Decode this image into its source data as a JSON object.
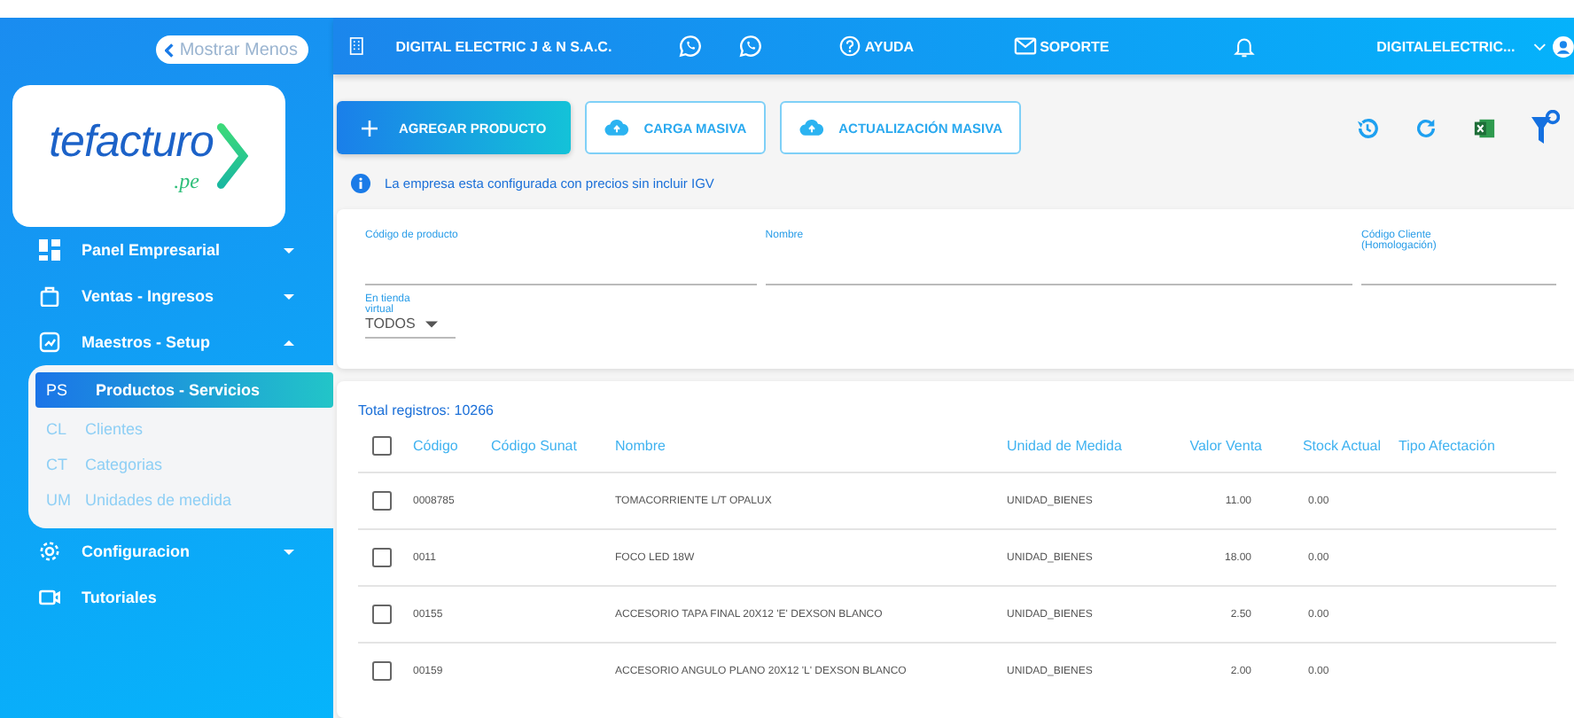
{
  "topbar": {
    "company": "DIGITAL ELECTRIC J & N S.A.C.",
    "help": "AYUDA",
    "support": "SOPORTE",
    "user": "DIGITALELECTRIC..."
  },
  "sidebar": {
    "collapse_label": "Mostrar Menos",
    "logo": {
      "name": "tefacturo",
      "domain": ".pe"
    },
    "items": [
      {
        "label": "Panel Empresarial",
        "kind": "group",
        "expanded": false
      },
      {
        "label": "Ventas - Ingresos",
        "kind": "group",
        "expanded": false
      },
      {
        "label": "Maestros - Setup",
        "kind": "group",
        "expanded": true,
        "children": [
          {
            "abbr": "PS",
            "label": "Productos - Servicios",
            "selected": true
          },
          {
            "abbr": "CL",
            "label": "Clientes",
            "selected": false
          },
          {
            "abbr": "CT",
            "label": "Categorias",
            "selected": false
          },
          {
            "abbr": "UM",
            "label": "Unidades de medida",
            "selected": false
          }
        ]
      },
      {
        "label": "Configuracion",
        "kind": "group",
        "expanded": false
      },
      {
        "label": "Tutoriales",
        "kind": "link"
      }
    ]
  },
  "toolbar": {
    "buttons": [
      {
        "label": "AGREGAR PRODUCTO",
        "kind": "primary"
      },
      {
        "label": "CARGA MASIVA",
        "kind": "outline"
      },
      {
        "label": "ACTUALIZACIÓN MASIVA",
        "kind": "outline"
      }
    ],
    "notice": "La empresa esta configurada con precios sin incluir IGV"
  },
  "filters": {
    "fields": [
      {
        "label": "Código de producto"
      },
      {
        "label": "Nombre"
      },
      {
        "label": "Código Cliente (Homologación)"
      }
    ],
    "select": {
      "label": "En tienda virtual",
      "value": "TODOS"
    }
  },
  "table": {
    "total": "Total registros: 10266",
    "all_checked": false,
    "columns": [
      "Código",
      "Código Sunat",
      "Nombre",
      "Unidad de Medida",
      "Valor Venta",
      "Stock Actual",
      "Tipo Afectación"
    ],
    "rows": [
      {
        "checked": false,
        "cells": [
          "0008785",
          "",
          "TOMACORRIENTE L/T OPALUX",
          "UNIDAD_BIENES",
          "11.00",
          "0.00",
          ""
        ]
      },
      {
        "checked": false,
        "cells": [
          "0011",
          "",
          "FOCO LED 18W",
          "UNIDAD_BIENES",
          "18.00",
          "0.00",
          ""
        ]
      },
      {
        "checked": false,
        "cells": [
          "00155",
          "",
          "ACCESORIO TAPA FINAL 20X12 'E' DEXSON BLANCO",
          "UNIDAD_BIENES",
          "2.50",
          "0.00",
          ""
        ]
      },
      {
        "checked": false,
        "cells": [
          "00159",
          "",
          "ACCESORIO ANGULO PLANO 20X12 'L' DEXSON BLANCO",
          "UNIDAD_BIENES",
          "2.00",
          "0.00",
          ""
        ]
      }
    ]
  }
}
